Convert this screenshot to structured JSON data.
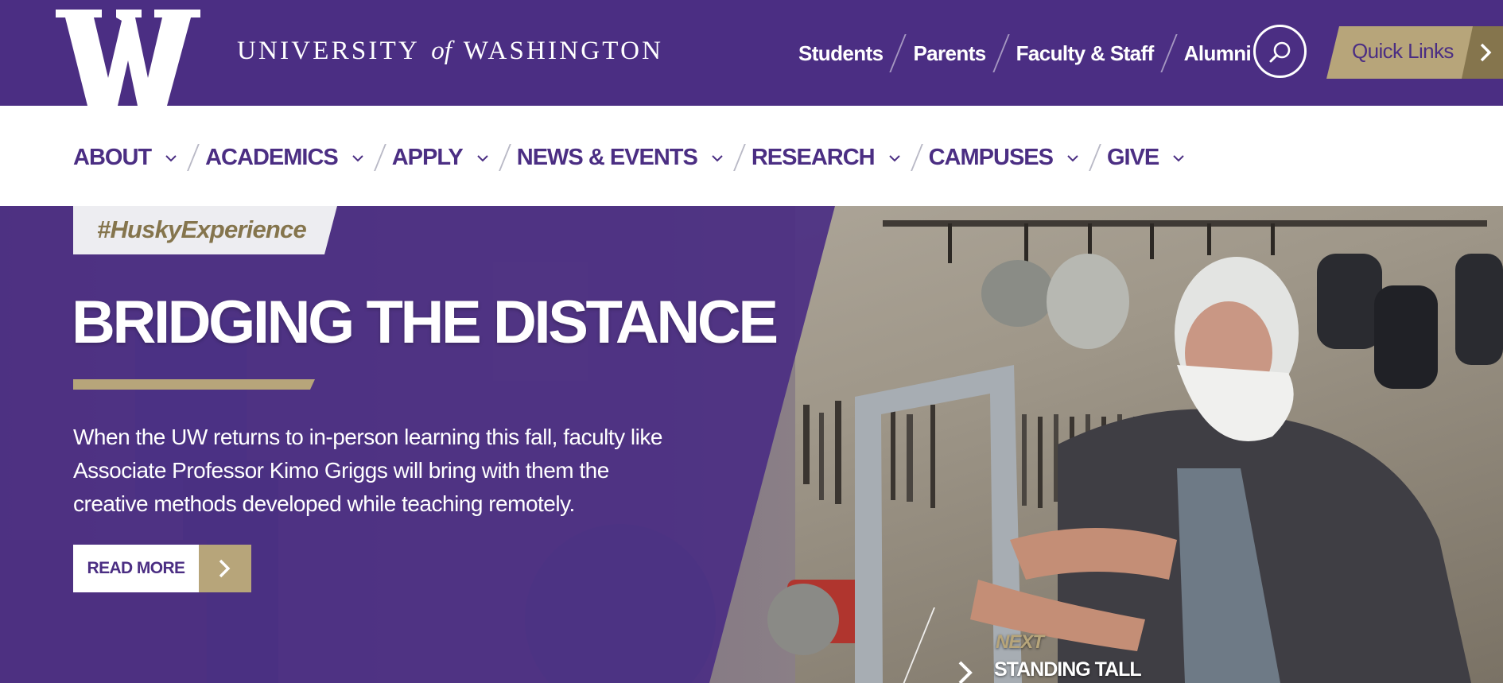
{
  "brand": {
    "wordmark_pre": "UNIVERSITY",
    "wordmark_of": "of",
    "wordmark_post": "WASHINGTON",
    "logo_icon": "w-logo-icon"
  },
  "audience_nav": [
    "Students",
    "Parents",
    "Faculty & Staff",
    "Alumni"
  ],
  "search": {
    "icon": "search-icon"
  },
  "quick_links": {
    "label": "Quick Links",
    "icon": "chevron-right-icon"
  },
  "main_nav": [
    "ABOUT",
    "ACADEMICS",
    "APPLY",
    "NEWS & EVENTS",
    "RESEARCH",
    "CAMPUSES",
    "GIVE"
  ],
  "hero": {
    "tag": "#HuskyExperience",
    "headline": "BRIDGING THE DISTANCE",
    "body": "When the UW returns to in-person learning this fall, faculty like Associate Professor Kimo Griggs will bring with them the creative methods developed while teaching remotely.",
    "cta_label": "READ MORE",
    "next_label": "NEXT",
    "next_title": "STANDING TALL"
  },
  "colors": {
    "purple": "#4b2e83",
    "gold": "#b7a57a",
    "dark_gold": "#85754d",
    "white": "#ffffff"
  }
}
